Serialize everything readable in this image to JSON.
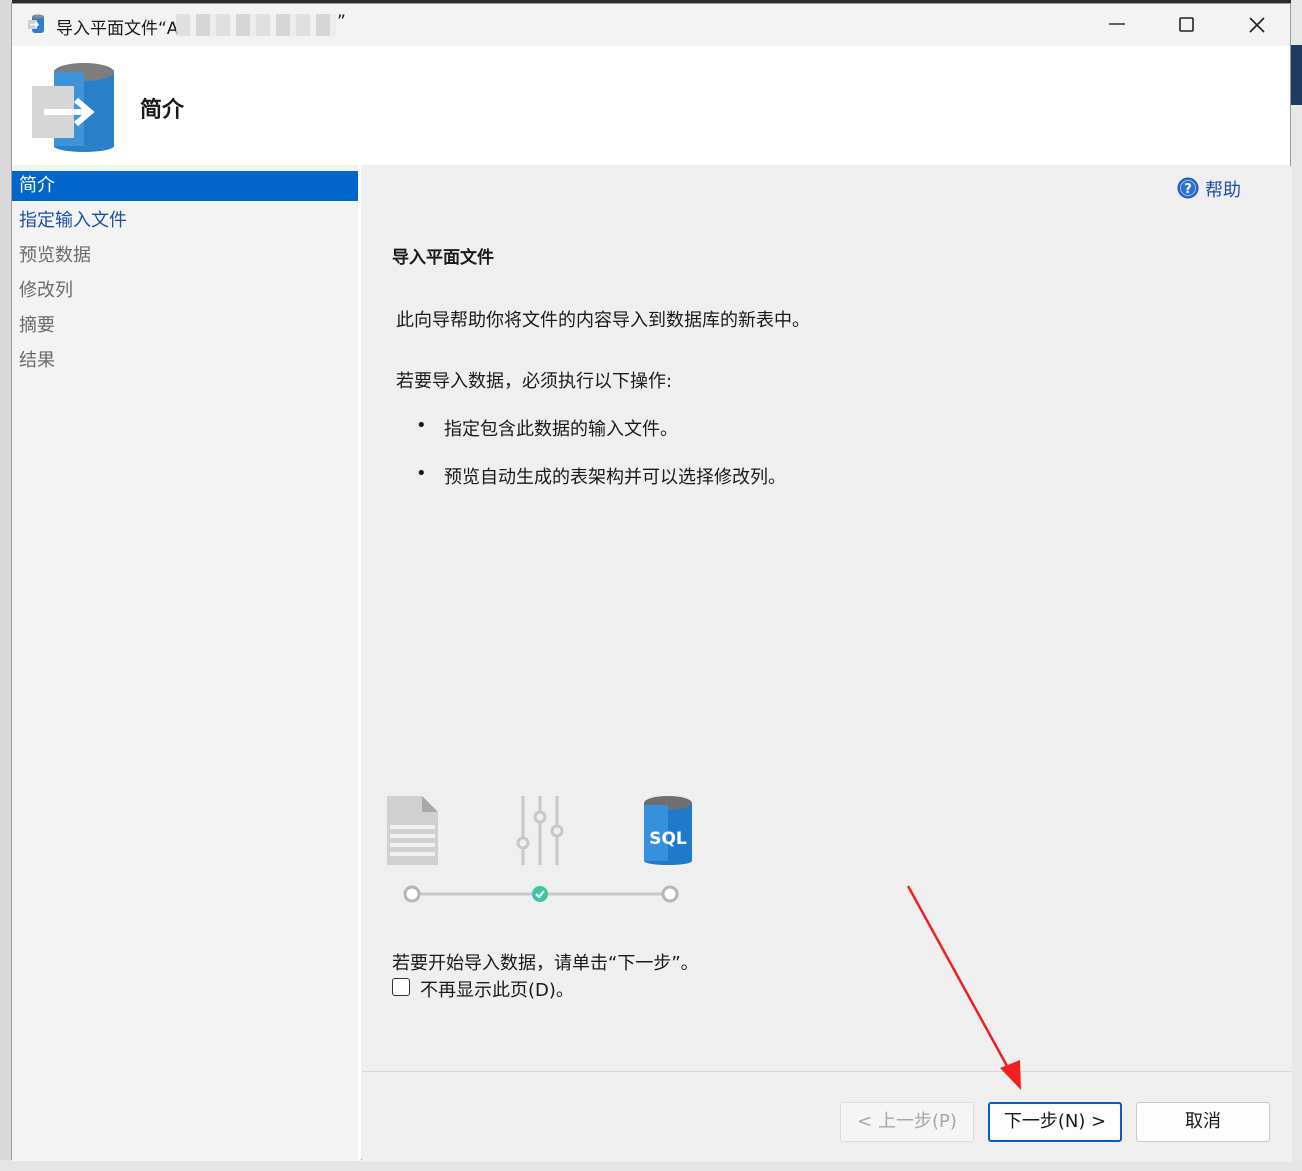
{
  "window": {
    "title": "导入平面文件“A",
    "title_close_quote": "”"
  },
  "header": {
    "title": "简介"
  },
  "sidebar": {
    "items": [
      {
        "label": "简介",
        "state": "active"
      },
      {
        "label": "指定输入文件",
        "state": "link"
      },
      {
        "label": "预览数据",
        "state": "disabled"
      },
      {
        "label": "修改列",
        "state": "disabled"
      },
      {
        "label": "摘要",
        "state": "disabled"
      },
      {
        "label": "结果",
        "state": "disabled"
      }
    ]
  },
  "content": {
    "help_label": "帮助",
    "section_title": "导入平面文件",
    "intro": "此向导帮助你将文件的内容导入到数据库的新表中。",
    "steps_intro": "若要导入数据，必须执行以下操作:",
    "bullets": [
      "指定包含此数据的输入文件。",
      "预览自动生成的表架构并可以选择修改列。"
    ],
    "bullet_char": "•",
    "illustration": {
      "sql_label": "SQL",
      "current_step": 2
    },
    "start_hint": "若要开始导入数据，请单击“下一步”。",
    "dont_show": {
      "label": "不再显示此页(D)。",
      "checked": false
    }
  },
  "footer": {
    "back_label": "< 上一步(P)",
    "next_label": "下一步(N) >",
    "cancel_label": "取消"
  },
  "colors": {
    "accent": "#0066cc",
    "link": "#1f4fa5",
    "arrow": "#f02020",
    "check": "#3cc5a0"
  }
}
